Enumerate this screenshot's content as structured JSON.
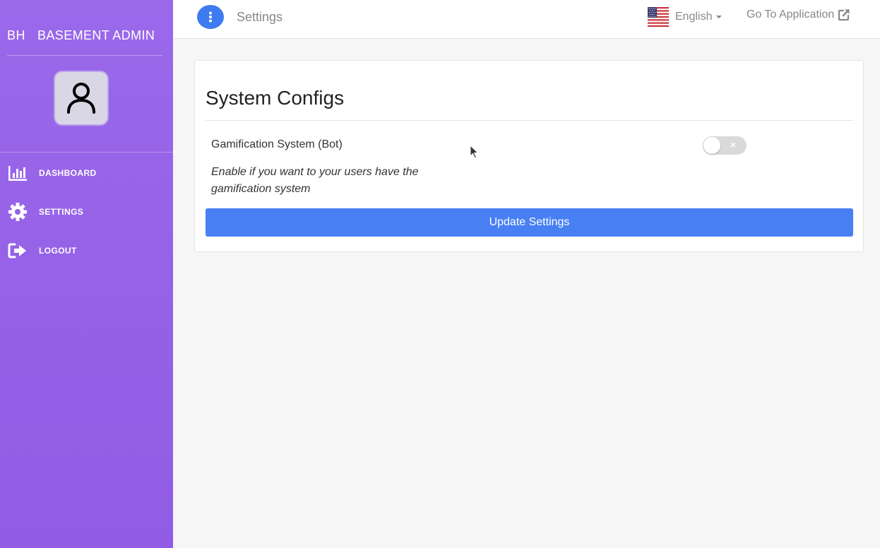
{
  "sidebar": {
    "brand_short": "BH",
    "brand_name": "BASEMENT ADMIN",
    "items": [
      {
        "label": "DASHBOARD",
        "icon": "bar-chart-icon"
      },
      {
        "label": "SETTINGS",
        "icon": "gear-icon"
      },
      {
        "label": "LOGOUT",
        "icon": "logout-icon"
      }
    ]
  },
  "header": {
    "title": "Settings",
    "language": "English",
    "go_to_app": "Go To Application"
  },
  "card": {
    "title": "System Configs",
    "setting": {
      "label": "Gamification System (Bot)",
      "help": "Enable if you want to your users have the gamification system",
      "enabled": false,
      "toggle_off_glyph": "×"
    },
    "update_label": "Update Settings"
  },
  "colors": {
    "sidebar_top": "#9a69ea",
    "sidebar_bottom": "#925be4",
    "primary": "#4880f3"
  }
}
